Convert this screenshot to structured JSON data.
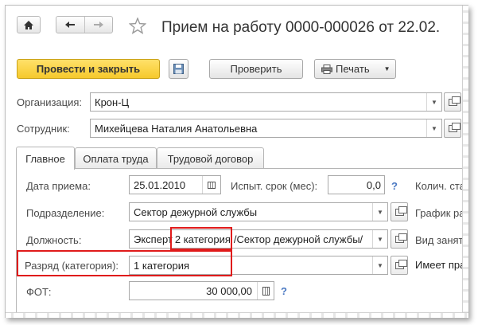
{
  "window": {
    "title": "Прием на работу 0000-000026 от 22.02."
  },
  "toolbar": {
    "post_close_label": "Провести и закрыть",
    "check_label": "Проверить",
    "print_label": "Печать"
  },
  "header_fields": {
    "organization": {
      "label": "Организация:",
      "value": "Крон-Ц"
    },
    "employee": {
      "label": "Сотрудник:",
      "value": "Михейцева Наталия Анатольевна"
    }
  },
  "tabs": [
    {
      "label": "Главное",
      "active": true
    },
    {
      "label": "Оплата труда",
      "active": false
    },
    {
      "label": "Трудовой договор",
      "active": false
    }
  ],
  "main": {
    "hire_date": {
      "label": "Дата приема:",
      "value": "25.01.2010"
    },
    "probation": {
      "label": "Испыт. срок (мес):",
      "value": "0,0"
    },
    "qty_rates_label": "Колич. став",
    "department": {
      "label": "Подразделение:",
      "value": "Сектор дежурной службы"
    },
    "schedule_label": "График раб",
    "position": {
      "label": "Должность:",
      "value_before": "Эксперт",
      "value_highlight": "2 категория",
      "value_after": "/Сектор дежурной службы/"
    },
    "occupancy_label": "Вид занято",
    "grade": {
      "label": "Разряд (категория):",
      "value": "1 категория"
    },
    "has_right_label": "Имеет прав",
    "fot": {
      "label": "ФОТ:",
      "value": "30 000,00"
    },
    "help_symbol": "?"
  },
  "colors": {
    "highlight_red": "#e01b1b",
    "primary_button": "#f6c92c",
    "help_blue": "#4a78c2"
  }
}
